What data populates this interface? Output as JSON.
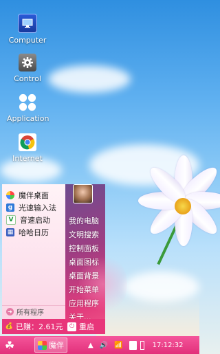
{
  "desktop": {
    "icons": [
      {
        "label": "Computer",
        "icon": "monitor-icon"
      },
      {
        "label": "Control",
        "icon": "gear-icon"
      },
      {
        "label": "Application",
        "icon": "apps-grid-icon"
      },
      {
        "label": "Internet",
        "icon": "chrome-icon"
      }
    ]
  },
  "start_menu": {
    "apps": [
      {
        "label": "魔伴桌面",
        "icon": "mobanzhuomian-icon"
      },
      {
        "label": "光速输入法",
        "icon": "ime-icon"
      },
      {
        "label": "音速启动",
        "icon": "vstart-icon"
      },
      {
        "label": "哈哈日历",
        "icon": "calendar-icon"
      }
    ],
    "all_programs": "所有程序",
    "system_links": [
      "我的电脑",
      "文明搜索",
      "控制面板",
      "桌面图标",
      "桌面背景",
      "开始菜单",
      "应用程序",
      "关于..."
    ],
    "balance": "已赚：2.61元",
    "restart": "重启"
  },
  "taskbar": {
    "start_icon": "clover-icon",
    "task_label": "魔伴",
    "time": "17:12:32"
  },
  "colors": {
    "accent": "#e8367a",
    "taskbar": "#f04c90"
  }
}
